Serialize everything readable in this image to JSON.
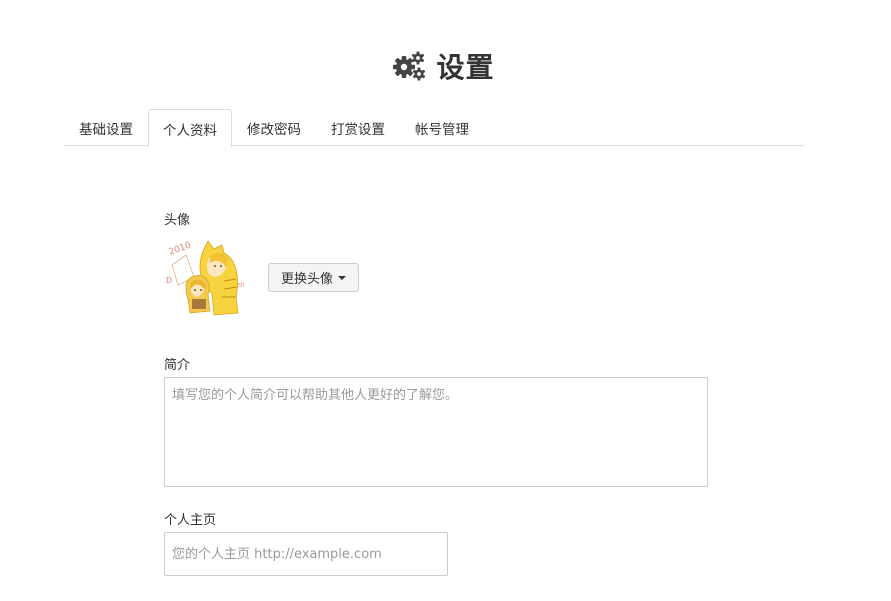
{
  "header": {
    "icon": "gears-icon",
    "title": "设置"
  },
  "tabs": [
    {
      "label": "基础设置",
      "active": false
    },
    {
      "label": "个人资料",
      "active": true
    },
    {
      "label": "修改密码",
      "active": false
    },
    {
      "label": "打赏设置",
      "active": false
    },
    {
      "label": "帐号管理",
      "active": false
    }
  ],
  "profile": {
    "avatar_label": "头像",
    "avatar_image": "anime-avatar-icon",
    "change_avatar_label": "更换头像",
    "bio_label": "简介",
    "bio_value": "",
    "bio_placeholder": "填写您的个人简介可以帮助其他人更好的了解您。",
    "homepage_label": "个人主页",
    "homepage_value": "",
    "homepage_placeholder": "您的个人主页 http://example.com"
  },
  "colors": {
    "text": "#333333",
    "border": "#cccccc",
    "tab_border": "#dddddd",
    "button_bg": "#f4f4f4",
    "placeholder": "#9a9a9a"
  }
}
